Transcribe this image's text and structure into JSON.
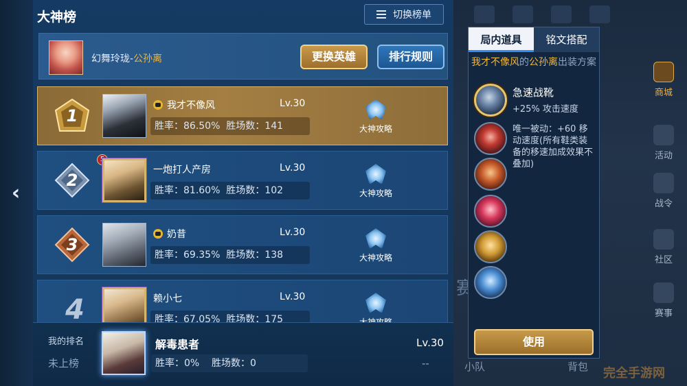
{
  "header": {
    "title": "大神榜",
    "switch_label": "切换榜单",
    "switch_icon": "list-icon"
  },
  "hero": {
    "name_prefix": "幻舞玲珑-",
    "hero_name": "公孙离",
    "change_hero": "更换英雄",
    "rank_rules": "排行规则"
  },
  "rows": [
    {
      "rank": "1",
      "name": "我才不像风",
      "vip": true,
      "level": "Lv.30",
      "winrate_label": "胜率：",
      "winrate": "86.50%",
      "wins_label": "胜场数：",
      "wins": "141",
      "guide": "大神攻略"
    },
    {
      "rank": "2",
      "name": "一炮打人产房",
      "vip": false,
      "badge": "5",
      "level": "Lv.30",
      "winrate_label": "胜率：",
      "winrate": "81.60%",
      "wins_label": "胜场数：",
      "wins": "102",
      "guide": "大神攻略"
    },
    {
      "rank": "3",
      "name": "奶昔",
      "vip": true,
      "level": "Lv.30",
      "winrate_label": "胜率：",
      "winrate": "69.35%",
      "wins_label": "胜场数：",
      "wins": "138",
      "guide": "大神攻略"
    },
    {
      "rank": "4",
      "name": "赖小七",
      "vip": false,
      "level": "Lv.30",
      "winrate_label": "胜率：",
      "winrate": "67.05%",
      "wins_label": "胜场数：",
      "wins": "175",
      "guide": "大神攻略"
    }
  ],
  "my_rank": {
    "title": "我的排名",
    "status": "未上榜",
    "name": "解毒患者",
    "level": "Lv.30",
    "winrate_label": "胜率：",
    "winrate": "0%",
    "wins_label": "胜场数：",
    "wins": "0",
    "rank_dash": "--"
  },
  "panel": {
    "tabs": [
      "局内道具",
      "铭文搭配"
    ],
    "sub_player": "我才不像风",
    "sub_mid": "的",
    "sub_hero": "公孙离",
    "sub_tail": "出装方案",
    "items": [
      {
        "name": "急速战靴",
        "effect": "+25% 攻击速度",
        "icon": "boots-icon"
      },
      {
        "desc": "唯一被动：+60 移动速度(所有鞋类装备的移速加成效果不叠加)",
        "icon": "bow-icon"
      },
      {
        "icon": "dagger-icon"
      },
      {
        "icon": "crossbow-icon"
      },
      {
        "icon": "blade-icon"
      },
      {
        "icon": "armor-icon"
      }
    ],
    "use_label": "使用"
  },
  "sidebar": [
    {
      "label": "商城",
      "icon": "shop-icon"
    },
    {
      "label": "活动",
      "icon": "gift-icon"
    },
    {
      "label": "战令",
      "icon": "horse-icon"
    },
    {
      "label": "社区",
      "icon": "home-icon"
    },
    {
      "label": "赛事",
      "icon": "trophy-icon"
    }
  ],
  "background": {
    "team": "小队",
    "bag": "背包",
    "banner_char": "赛"
  },
  "watermark": "完全手游网",
  "colors": {
    "gold": "#f0b73a",
    "panel_bg": "#132640",
    "accent_blue": "#2f8df0"
  }
}
